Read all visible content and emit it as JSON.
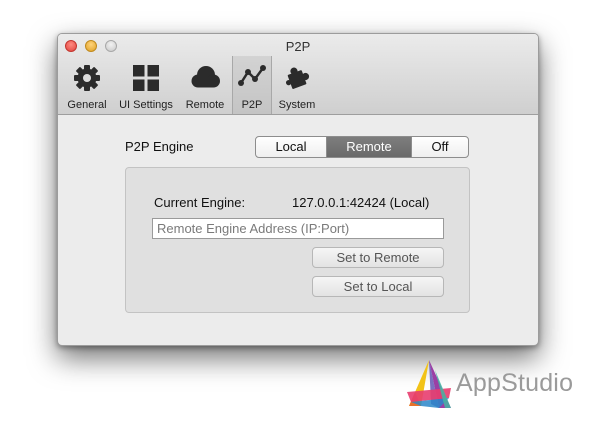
{
  "window": {
    "title": "P2P"
  },
  "toolbar": {
    "items": [
      {
        "label": "General",
        "icon": "gear-icon"
      },
      {
        "label": "UI Settings",
        "icon": "grid-icon"
      },
      {
        "label": "Remote",
        "icon": "cloud-icon"
      },
      {
        "label": "P2P",
        "icon": "chart-line-icon",
        "selected": true
      },
      {
        "label": "System",
        "icon": "puzzle-icon"
      }
    ]
  },
  "p2p": {
    "engine_label": "P2P Engine",
    "segments": [
      "Local",
      "Remote",
      "Off"
    ],
    "selected_segment": "Remote",
    "current_engine_label": "Current Engine:",
    "current_engine_value": "127.0.0.1:42424 (Local)",
    "address_value": "",
    "address_placeholder": "Remote Engine Address (IP:Port)",
    "set_remote_label": "Set to Remote",
    "set_local_label": "Set to Local"
  },
  "watermark": {
    "text": "AppStudio"
  },
  "colors": {
    "selected_segment": "#727272",
    "window_bg": "#ececec",
    "close": "#e0443e",
    "minimize": "#dfa125",
    "zoom": "#c8c8c8"
  }
}
